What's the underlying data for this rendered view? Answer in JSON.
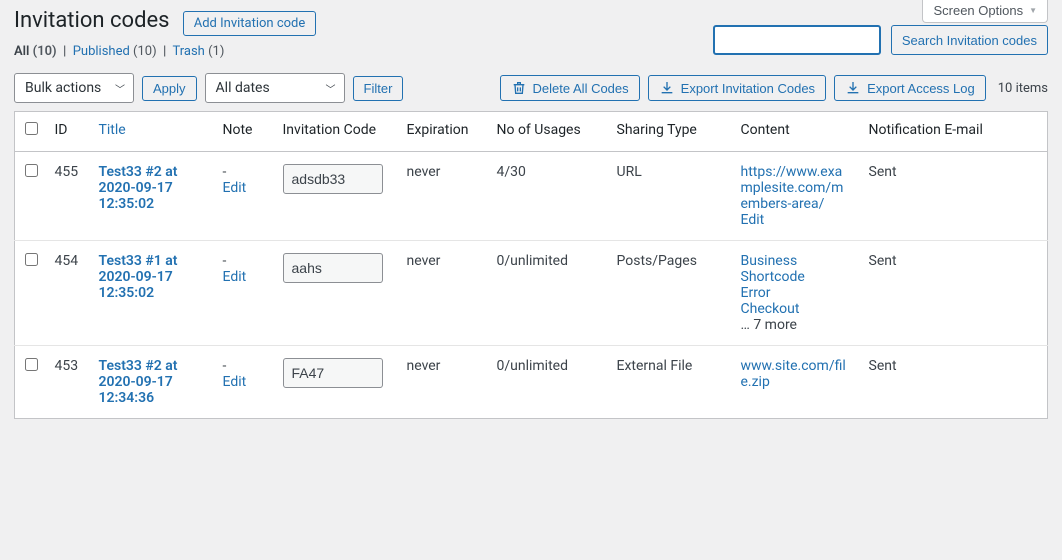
{
  "screen_options_label": "Screen Options",
  "page_title": "Invitation codes",
  "add_button": "Add Invitation code",
  "views": {
    "all": {
      "label": "All",
      "count": "(10)"
    },
    "published": {
      "label": "Published",
      "count": "(10)"
    },
    "trash": {
      "label": "Trash",
      "count": "(1)"
    }
  },
  "search_button": "Search Invitation codes",
  "bulk_label": "Bulk actions",
  "apply_label": "Apply",
  "dates_label": "All dates",
  "filter_label": "Filter",
  "actions": {
    "delete_all": "Delete All Codes",
    "export_codes": "Export Invitation Codes",
    "export_log": "Export Access Log"
  },
  "items_text": "10 items",
  "columns": {
    "id": "ID",
    "title": "Title",
    "note": "Note",
    "code": "Invitation Code",
    "expiration": "Expiration",
    "usages": "No of Usages",
    "sharing": "Sharing Type",
    "content": "Content",
    "notification": "Notification E-mail"
  },
  "edit_label": "Edit",
  "rows": [
    {
      "id": "455",
      "title": "Test33 #2 at 2020-09-17 12:35:02",
      "note": "-",
      "code": "adsdb33",
      "expiration": "never",
      "usages": "4/30",
      "sharing": "URL",
      "content_lines": [
        "https://www.examplesite.com/members-area/"
      ],
      "content_edit": true,
      "content_more": "",
      "notification": "Sent"
    },
    {
      "id": "454",
      "title": "Test33 #1 at 2020-09-17 12:35:02",
      "note": "-",
      "code": "aahs",
      "expiration": "never",
      "usages": "0/unlimited",
      "sharing": "Posts/Pages",
      "content_lines": [
        "Business",
        "Shortcode",
        "Error",
        "Checkout"
      ],
      "content_edit": false,
      "content_more": "… 7 more",
      "notification": "Sent"
    },
    {
      "id": "453",
      "title": "Test33 #2 at 2020-09-17 12:34:36",
      "note": "-",
      "code": "FA47",
      "expiration": "never",
      "usages": "0/unlimited",
      "sharing": "External File",
      "content_lines": [
        "www.site.com/file.zip"
      ],
      "content_edit": false,
      "content_more": "",
      "notification": "Sent"
    }
  ]
}
